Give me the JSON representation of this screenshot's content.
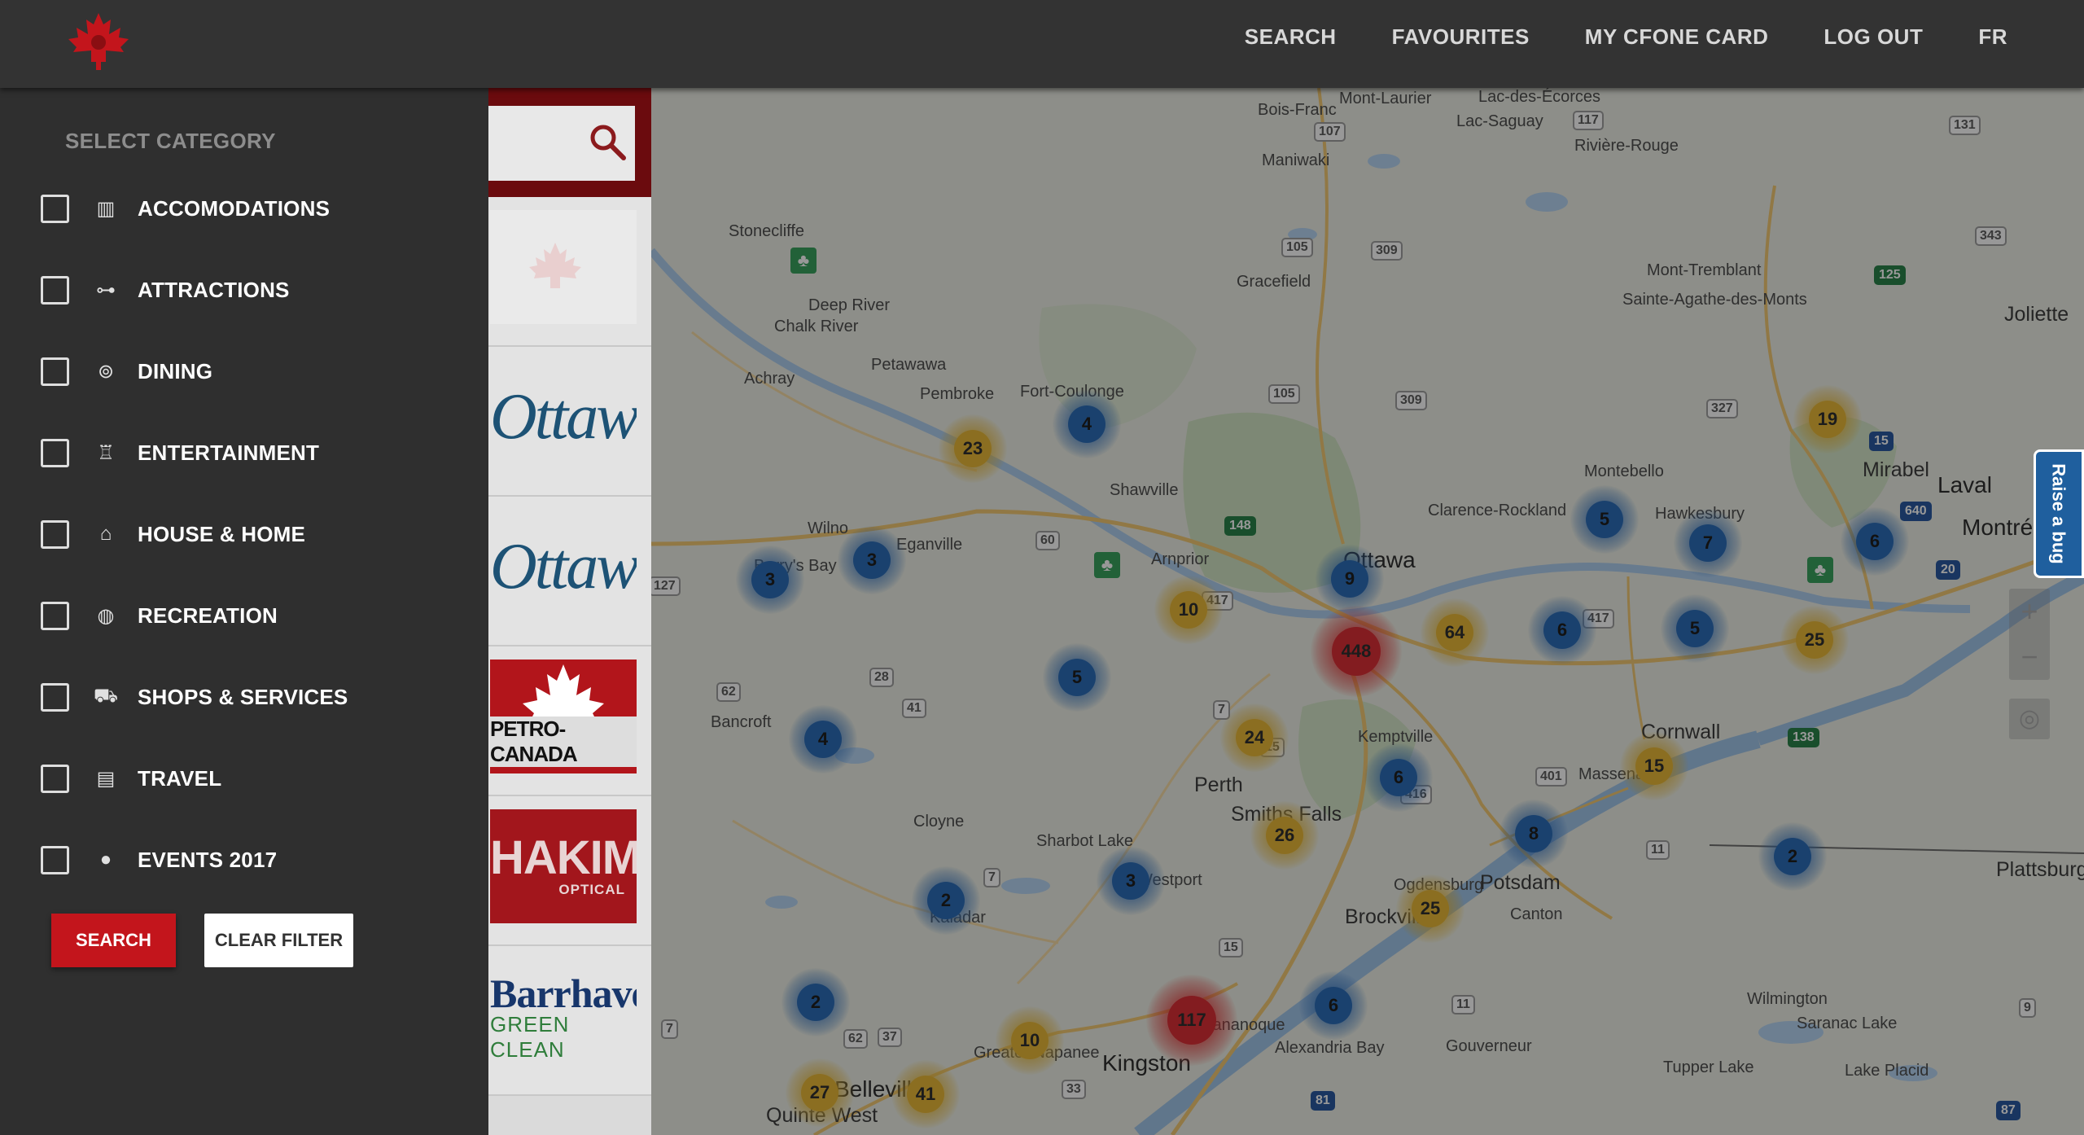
{
  "nav": {
    "search": "SEARCH",
    "favourites": "FAVOURITES",
    "card": "MY CFONE CARD",
    "logout": "LOG OUT",
    "lang": "FR"
  },
  "sidebar": {
    "heading": "SELECT CATEGORY",
    "categories": [
      {
        "label": "ACCOMODATIONS",
        "icon": "hotel-icon",
        "checked": false
      },
      {
        "label": "ATTRACTIONS",
        "icon": "binoculars-icon",
        "checked": false
      },
      {
        "label": "DINING",
        "icon": "dining-icon",
        "checked": false
      },
      {
        "label": "ENTERTAINMENT",
        "icon": "popcorn-icon",
        "checked": false
      },
      {
        "label": "HOUSE & HOME",
        "icon": "home-icon",
        "checked": false
      },
      {
        "label": "RECREATION",
        "icon": "ball-icon",
        "checked": false
      },
      {
        "label": "SHOPS & SERVICES",
        "icon": "cart-icon",
        "checked": false
      },
      {
        "label": "TRAVEL",
        "icon": "luggage-icon",
        "checked": false
      },
      {
        "label": "EVENTS 2017",
        "icon": "dot-icon",
        "checked": false
      }
    ],
    "search_button": "SEARCH",
    "clear_button": "CLEAR FILTER"
  },
  "listing": {
    "cards": [
      {
        "name": "logo-placeholder"
      },
      {
        "name": "Ottawa"
      },
      {
        "name": "Ottawa"
      },
      {
        "name": "PETRO-CANADA"
      },
      {
        "name": "HAKIM",
        "sub": "OPTICAL"
      },
      {
        "name": "Barrhaven",
        "sub": "GREEN CLEAN"
      }
    ]
  },
  "map": {
    "places": [
      "Mont-Laurier",
      "Lac-des-Écorces",
      "Bois-Franc",
      "Lac-Saguay",
      "Rivière-Rouge",
      "Maniwaki",
      "Stonecliffe",
      "Gracefield",
      "Mont-Tremblant",
      "Sainte-Agathe-des-Monts",
      "Joliette",
      "Deep River",
      "Chalk River",
      "Petawawa",
      "Achray",
      "Pembroke",
      "Fort-Coulonge",
      "Shawville",
      "Mirabel",
      "Laval",
      "Montréal",
      "Montebello",
      "Clarence-Rockland",
      "Hawkesbury",
      "Wilno",
      "Barry's Bay",
      "Eganville",
      "Arnprior",
      "Ottawa",
      "Bancroft",
      "Perth",
      "Smiths Falls",
      "Kemptville",
      "Cornwall",
      "Massena",
      "Cloyne",
      "Sharbot Lake",
      "Westport",
      "Kaladar",
      "Brockville",
      "Ogdensburg",
      "Potsdam",
      "Canton",
      "Plattsburgh",
      "Greater Napanee",
      "Kingston",
      "Gananoque",
      "Alexandria Bay",
      "Gouverneur",
      "Wilmington",
      "Saranac Lake",
      "Tupper Lake",
      "Lake Placid",
      "Belleville",
      "Quinte West"
    ],
    "clusters": [
      {
        "count": 4,
        "color": "blue"
      },
      {
        "count": 23,
        "color": "yellow"
      },
      {
        "count": 19,
        "color": "yellow"
      },
      {
        "count": 3,
        "color": "blue"
      },
      {
        "count": 3,
        "color": "blue"
      },
      {
        "count": 5,
        "color": "blue"
      },
      {
        "count": 7,
        "color": "blue"
      },
      {
        "count": 6,
        "color": "blue"
      },
      {
        "count": 9,
        "color": "blue"
      },
      {
        "count": 10,
        "color": "yellow"
      },
      {
        "count": 5,
        "color": "blue"
      },
      {
        "count": 64,
        "color": "yellow"
      },
      {
        "count": 448,
        "color": "red"
      },
      {
        "count": 6,
        "color": "blue"
      },
      {
        "count": 5,
        "color": "blue"
      },
      {
        "count": 25,
        "color": "yellow"
      },
      {
        "count": 4,
        "color": "blue"
      },
      {
        "count": 24,
        "color": "yellow"
      },
      {
        "count": 6,
        "color": "blue"
      },
      {
        "count": 15,
        "color": "yellow"
      },
      {
        "count": 26,
        "color": "yellow"
      },
      {
        "count": 8,
        "color": "blue"
      },
      {
        "count": 2,
        "color": "blue"
      },
      {
        "count": 3,
        "color": "blue"
      },
      {
        "count": 2,
        "color": "blue"
      },
      {
        "count": 25,
        "color": "yellow"
      },
      {
        "count": 2,
        "color": "blue"
      },
      {
        "count": 6,
        "color": "blue"
      },
      {
        "count": 117,
        "color": "red"
      },
      {
        "count": 10,
        "color": "yellow"
      },
      {
        "count": 27,
        "color": "yellow"
      },
      {
        "count": 41,
        "color": "yellow"
      }
    ],
    "zoom_in": "+",
    "zoom_out": "−",
    "raise_bug": "Raise a bug"
  },
  "colors": {
    "brand_red": "#c3151c",
    "topbar": "#333333",
    "sidebar": "#2f2f2f"
  }
}
